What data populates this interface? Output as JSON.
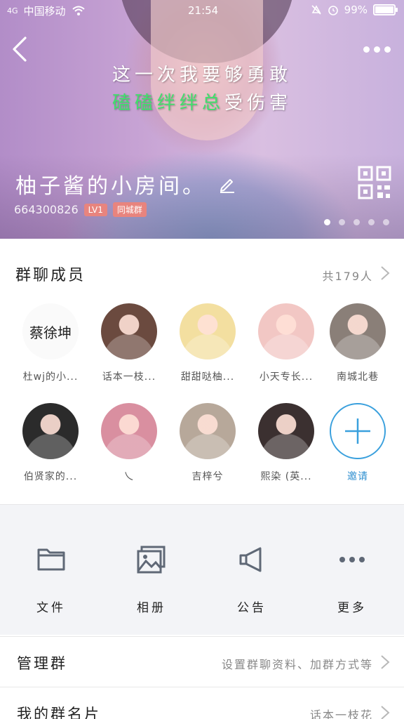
{
  "status_bar": {
    "signal": "4G",
    "carrier": "中国移动",
    "time": "21:54",
    "battery": "99%",
    "battery_level": 0.99
  },
  "header": {
    "lyric_line1": "这一次我要够勇敢",
    "lyric_line2_green": "磕磕绊绊总",
    "lyric_line2_white": "受伤害",
    "group_name": "柚子酱的小房间。",
    "group_id": "664300826",
    "level_tag": "LV1",
    "category_tag": "同城群",
    "page_count": 5,
    "active_page": 0
  },
  "members": {
    "title": "群聊成员",
    "count": "共179人",
    "items": [
      {
        "label": "杜wj的小...",
        "avatar_text": "蔡徐坤",
        "color": "#fafafa"
      },
      {
        "label": "话本一枝...",
        "color": "#6b4a3f"
      },
      {
        "label": "甜甜哒柚...",
        "color": "#f3dfa0"
      },
      {
        "label": "小天专长...",
        "color": "#f2c7c4"
      },
      {
        "label": "南城北巷",
        "color": "#8a7f78"
      },
      {
        "label": "伯贤家的...",
        "color": "#2b2b2b"
      },
      {
        "label": "乀",
        "color": "#d98fa0"
      },
      {
        "label": "吉梓兮",
        "color": "#b7a89a"
      },
      {
        "label": "熙染 (英...",
        "color": "#3b3030"
      },
      {
        "label": "邀请",
        "invite": true
      }
    ]
  },
  "tools": [
    {
      "label": "文件",
      "icon": "folder-icon"
    },
    {
      "label": "相册",
      "icon": "album-icon"
    },
    {
      "label": "公告",
      "icon": "announcement-icon"
    },
    {
      "label": "更多",
      "icon": "more-dots-icon"
    }
  ],
  "manage": {
    "title": "管理群",
    "value": "设置群聊资料、加群方式等"
  },
  "my_card": {
    "title": "我的群名片",
    "value": "话本一枝花"
  }
}
